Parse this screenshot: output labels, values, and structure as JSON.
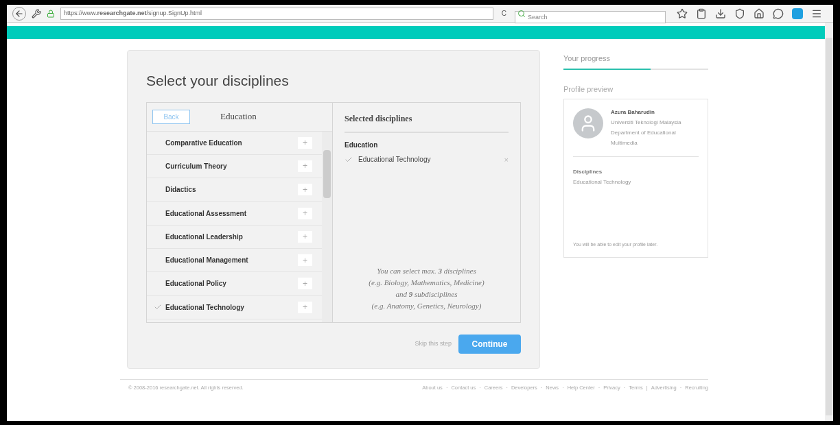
{
  "browser": {
    "url": "https://www.**researchgate.net**/signup.SignUp.html",
    "reload": "C",
    "search": {
      "placeholder": "Search"
    }
  },
  "main": {
    "title": "Select your disciplines",
    "left": {
      "back": "Back",
      "heading": "Education",
      "items": [
        {
          "label": "Comparative Education",
          "checked": false,
          "add": "+"
        },
        {
          "label": "Curriculum Theory",
          "checked": false,
          "add": "+"
        },
        {
          "label": "Didactics",
          "checked": false,
          "add": "+"
        },
        {
          "label": "Educational Assessment",
          "checked": false,
          "add": "+"
        },
        {
          "label": "Educational Leadership",
          "checked": false,
          "add": "+"
        },
        {
          "label": "Educational Management",
          "checked": false,
          "add": "+"
        },
        {
          "label": "Educational Policy",
          "checked": false,
          "add": "+"
        },
        {
          "label": "Educational Technology",
          "checked": true,
          "add": "+"
        }
      ]
    },
    "right": {
      "heading": "Selected disciplines",
      "group": "Education",
      "selected": [
        {
          "label": "Educational Technology",
          "remove": "×"
        }
      ],
      "hint": [
        "You can select max. **3** disciplines",
        "(e.g. Biology, Mathematics, Medicine)",
        "and **9** subdisciplines",
        "(e.g. Anatomy, Genetics, Neurology)"
      ]
    },
    "skip": "Skip this step",
    "continue": "Continue"
  },
  "sidebar": {
    "progress_label": "Your progress",
    "progress": {
      "level": 0.6
    },
    "preview_label": "Profile preview",
    "profile": {
      "name": "Azura Baharudin",
      "affiliation": [
        "Universiti Teknologi Malaysia",
        "Department of Educational",
        "Multimedia"
      ],
      "disciplines_label": "Disciplines",
      "disciplines": "Educational Technology",
      "note": "You will be able to edit your profile later."
    }
  },
  "footer": {
    "copyright": "© 2008-2016 researchgate.net. All rights reserved.",
    "links": [
      {
        "label": "About us",
        "separator": "·"
      },
      {
        "label": "Contact us",
        "separator": "·"
      },
      {
        "label": "Careers",
        "separator": "·"
      },
      {
        "label": "Developers",
        "separator": "·"
      },
      {
        "label": "News",
        "separator": "·"
      },
      {
        "label": "Help Center",
        "separator": "·"
      },
      {
        "label": "Privacy",
        "separator": "·"
      },
      {
        "label": "Terms",
        "separator": "|"
      },
      {
        "label": "Advertising",
        "separator": "·"
      },
      {
        "label": "Recruiting"
      }
    ]
  }
}
